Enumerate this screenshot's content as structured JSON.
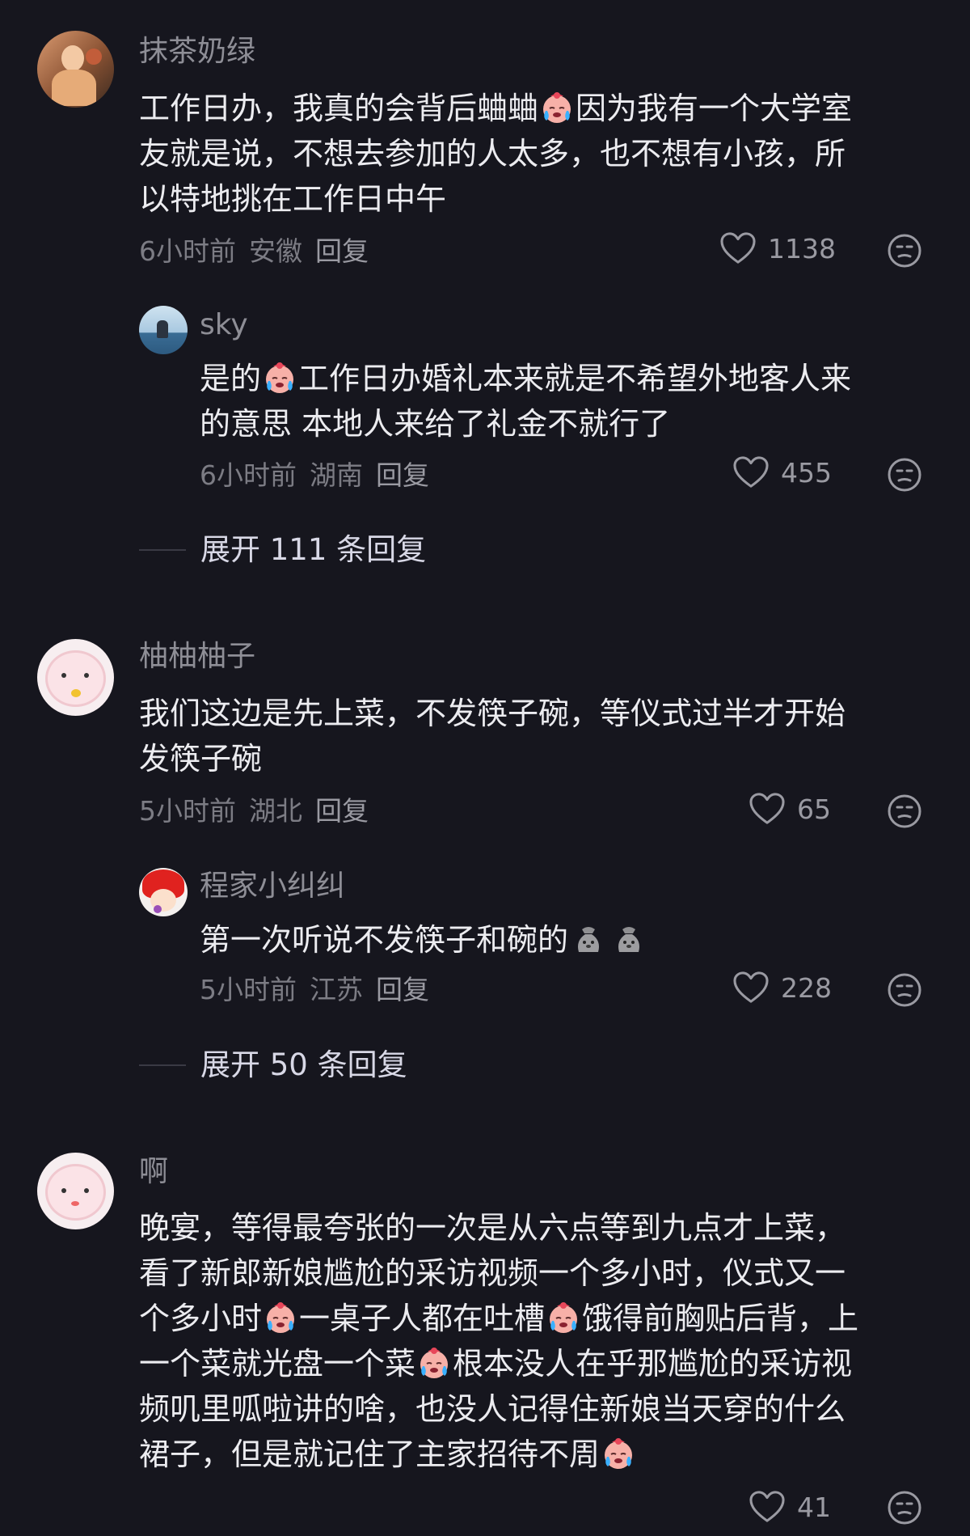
{
  "comments": [
    {
      "name": "抹茶奶绿",
      "lines": [
        "工作日办，我真的会背后蛐蛐",
        "因为我有一个大学室",
        "友就是说，不想去参加的人太多，也不想有小孩，所",
        "以特地挑在工作日中午"
      ],
      "time": "6小时前",
      "location": "安徽",
      "reply": "回复",
      "likes": "1138"
    },
    {
      "name": "sky",
      "lines": [
        "是的",
        "工作日办婚礼本来就是不希望外地客人来",
        "的意思 本地人来给了礼金不就行了"
      ],
      "time": "6小时前",
      "location": "湖南",
      "reply": "回复",
      "likes": "455"
    },
    {
      "expand": "展开 111 条回复"
    },
    {
      "name": "柚柚柚子",
      "lines": [
        "我们这边是先上菜，不发筷子碗，等仪式过半才开始",
        "发筷子碗"
      ],
      "time": "5小时前",
      "location": "湖北",
      "reply": "回复",
      "likes": "65"
    },
    {
      "name": "程家小纠纠",
      "lines": [
        "第一次听说不发筷子和碗的"
      ],
      "time": "5小时前",
      "location": "江苏",
      "reply": "回复",
      "likes": "228"
    },
    {
      "expand": "展开 50 条回复"
    },
    {
      "name": "啊",
      "lines": [
        "晚宴，等得最夸张的一次是从六点等到九点才上菜，",
        "看了新郎新娘尴尬的采访视频一个多小时，仪式又一",
        "个多小时",
        "一桌子人都在吐槽",
        "饿得前胸贴后背，上",
        "一个菜就光盘一个菜",
        "根本没人在乎那尴尬的采访视",
        "频叽里呱啦讲的啥，也没人记得住新娘当天穿的什么",
        "裙子，但是就记住了主家招待不周"
      ],
      "likes": "41"
    }
  ],
  "icons": {
    "like": "heart-outline-icon",
    "dislike": "unamused-face-icon",
    "cry_emoji": "crying-face-emoji",
    "bag_emoji": "money-bag-emoji"
  },
  "colors": {
    "background": "#16161e",
    "name": "#8e8e96",
    "text": "#ececf0",
    "meta": "#7c7c84"
  }
}
